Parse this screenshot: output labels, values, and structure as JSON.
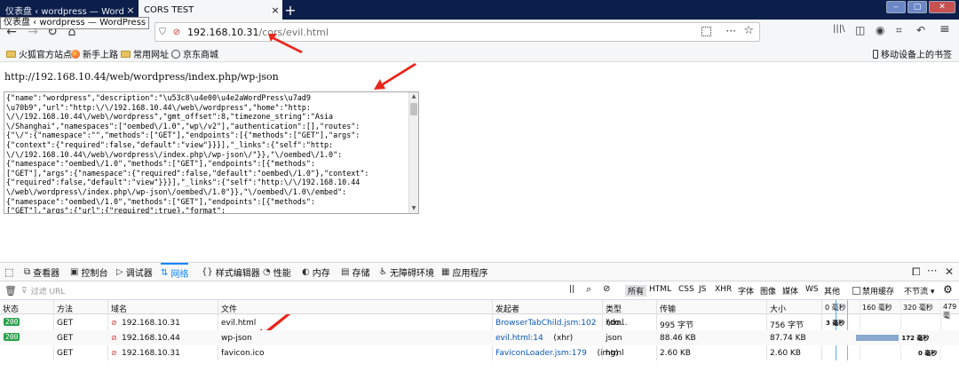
{
  "tabs": [
    {
      "title": "仪表盘 ‹ wordpress — WordPress",
      "close": "×"
    },
    {
      "title": "CORS TEST",
      "close": "×"
    }
  ],
  "new_tab": "+",
  "tooltip": "仪表盘 ‹ wordpress — WordPress",
  "window_controls": {
    "min": "‒",
    "max": "▢",
    "close": "✕"
  },
  "nav": {
    "back_icon": "back-icon",
    "back": "←",
    "forward": "→",
    "reload": "↻",
    "home": "⌂",
    "url_host": "192.168.10.31",
    "url_path": "/cors/evil.html",
    "shield": "⛉",
    "insecure": "⊘",
    "page_actions": "···",
    "bookmark_star": "☆"
  },
  "right_tools": {
    "library": "|||\\",
    "sidebar": "◫",
    "account": "◉",
    "screenshot": "⌗",
    "undo": "↶",
    "menu": "≡"
  },
  "bookmarks": [
    {
      "label": "火狐官方站点",
      "icon": "folder-icon"
    },
    {
      "label": "新手上路",
      "icon": "firefox-icon"
    },
    {
      "label": "常用网址",
      "icon": "folder-icon"
    },
    {
      "label": "京东商城",
      "icon": "globe-icon"
    }
  ],
  "mobile_bookmarks": "移动设备上的书签",
  "page": {
    "url_text": "http://192.168.10.44/web/wordpress/index.php/wp-json",
    "json_text": "{\"name\":\"wordpress\",\"description\":\"\\u53c8\\u4e00\\u4e2aWordPress\\u7ad9\n\\u70b9\",\"url\":\"http:\\/\\/192.168.10.44\\/web\\/wordpress\",\"home\":\"http:\n\\/\\/192.168.10.44\\/web\\/wordpress\",\"gmt_offset\":8,\"timezone_string\":\"Asia\n\\/Shanghai\",\"namespaces\":[\"oembed\\/1.0\",\"wp\\/v2\"],\"authentication\":[],\"routes\":\n{\"\\/\":{\"namespace\":\"\",\"methods\":[\"GET\"],\"endpoints\":[{\"methods\":[\"GET\"],\"args\":\n{\"context\":{\"required\":false,\"default\":\"view\"}}}],\"_links\":{\"self\":\"http:\n\\/\\/192.168.10.44\\/web\\/wordpress\\/index.php\\/wp-json\\/\"}},\"\\/oembed\\/1.0\":\n{\"namespace\":\"oembed\\/1.0\",\"methods\":[\"GET\"],\"endpoints\":[{\"methods\":\n[\"GET\"],\"args\":{\"namespace\":{\"required\":false,\"default\":\"oembed\\/1.0\"},\"context\":\n{\"required\":false,\"default\":\"view\"}}}],\"_links\":{\"self\":\"http:\\/\\/192.168.10.44\n\\/web\\/wordpress\\/index.php\\/wp-json\\/oembed\\/1.0\"}},\"\\/oembed\\/1.0\\/embed\":\n{\"namespace\":\"oembed\\/1.0\",\"methods\":[\"GET\"],\"endpoints\":[{\"methods\":\n[\"GET\"],\"args\":{\"url\":{\"required\":true},\"format\":"
  },
  "devtools": {
    "tabs": [
      {
        "label": "查看器",
        "icon": "⧉"
      },
      {
        "label": "控制台",
        "icon": "▣"
      },
      {
        "label": "调试器",
        "icon": "▷"
      },
      {
        "label": "网络",
        "icon": "⇅"
      },
      {
        "label": "样式编辑器",
        "icon": "{}"
      },
      {
        "label": "性能",
        "icon": "◔"
      },
      {
        "label": "内存",
        "icon": "◐"
      },
      {
        "label": "存储",
        "icon": "▤"
      },
      {
        "label": "无障碍环境",
        "icon": "♿"
      },
      {
        "label": "应用程序",
        "icon": "▦"
      }
    ],
    "active_tab": "网络",
    "inspect_icon": "⬚",
    "dock": "⧠",
    "more": "···",
    "close": "✕",
    "filter_placeholder": "过滤 URL",
    "filter_icon": "⊽",
    "pause": "||",
    "search": "⌕",
    "block": "⊘",
    "type_filters": [
      "所有",
      "HTML",
      "CSS",
      "JS",
      "XHR",
      "字体",
      "图像",
      "媒体",
      "WS",
      "其他"
    ],
    "disable_cache": "禁用缓存",
    "throttle": "不节流 ▾",
    "settings": "⚙",
    "columns": [
      "状态",
      "方法",
      "域名",
      "文件",
      "发起者",
      "类型",
      "传输",
      "大小"
    ],
    "waterfall_ticks": [
      "0 毫秒",
      "160 毫秒",
      "320 毫秒",
      "479 毫"
    ],
    "requests": [
      {
        "status": "200",
        "method": "GET",
        "domain": "192.168.10.31",
        "file": "evil.html",
        "initiator": "BrowserTabChild.jsm:102",
        "initiator_extra": " (do...",
        "type": "html",
        "transfer": "995 字节",
        "size": "756 字节",
        "timing": "3 毫秒",
        "wf_start": 0,
        "wf_ms": 3
      },
      {
        "status": "200",
        "method": "GET",
        "domain": "192.168.10.44",
        "file": "wp-json",
        "initiator": "evil.html:14",
        "initiator_extra": " (xhr)",
        "type": "json",
        "transfer": "88.46 KB",
        "size": "87.74 KB",
        "timing": "172 毫秒",
        "wf_start": 128,
        "wf_ms": 172
      },
      {
        "status": "",
        "method": "GET",
        "domain": "192.168.10.31",
        "file": "favicon.ico",
        "initiator": "FaviconLoader.jsm:179",
        "initiator_extra": " (img)",
        "type": "html",
        "transfer": "2.60 KB",
        "size": "2.60 KB",
        "timing": "0 毫秒",
        "wf_start": 0,
        "wf_ms": 0
      }
    ]
  }
}
